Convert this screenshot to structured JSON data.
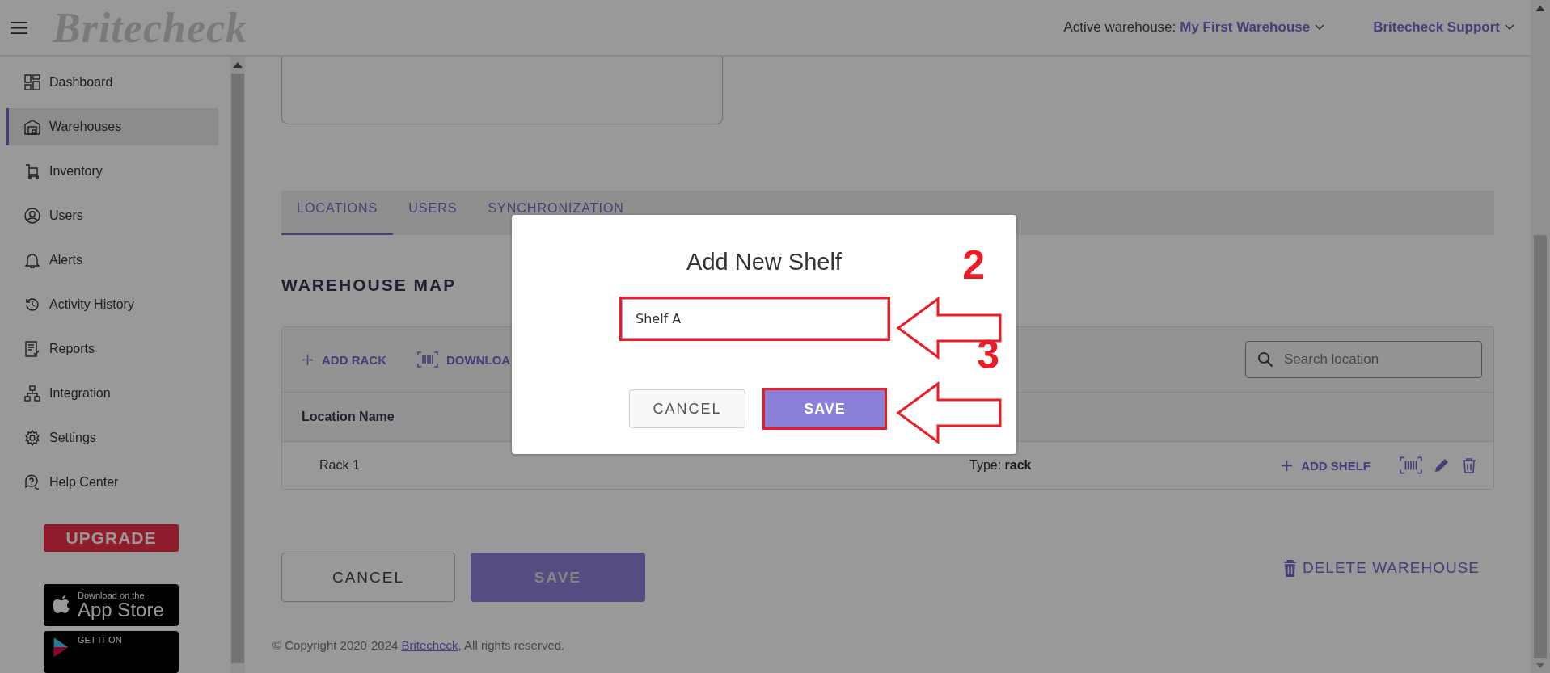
{
  "header": {
    "logo": "Britecheck",
    "active_label": "Active warehouse:",
    "active_warehouse": "My First Warehouse",
    "user": "Britecheck Support"
  },
  "sidebar": {
    "items": [
      {
        "label": "Dashboard",
        "selected": false
      },
      {
        "label": "Warehouses",
        "selected": true
      },
      {
        "label": "Inventory",
        "selected": false
      },
      {
        "label": "Users",
        "selected": false
      },
      {
        "label": "Alerts",
        "selected": false
      },
      {
        "label": "Activity History",
        "selected": false
      },
      {
        "label": "Reports",
        "selected": false
      },
      {
        "label": "Integration",
        "selected": false
      },
      {
        "label": "Settings",
        "selected": false
      },
      {
        "label": "Help Center",
        "selected": false
      }
    ],
    "upgrade": "UPGRADE",
    "app_store": {
      "small": "Download on the",
      "big": "App Store"
    },
    "google_play": {
      "small": "GET IT ON"
    }
  },
  "tabs": [
    {
      "label": "LOCATIONS",
      "selected": true
    },
    {
      "label": "USERS",
      "selected": false
    },
    {
      "label": "SYNCHRONIZATION",
      "selected": false
    }
  ],
  "section_title": "WAREHOUSE MAP",
  "toolbar": {
    "add_rack": "ADD RACK",
    "download": "DOWNLOA",
    "search_placeholder": "Search location"
  },
  "table": {
    "columns": [
      "Location Name"
    ],
    "rows": [
      {
        "name": "Rack 1",
        "type": "Type: **rack**",
        "add_shelf": "ADD SHELF"
      }
    ]
  },
  "form_buttons": {
    "cancel": "CANCEL",
    "save": "SAVE",
    "delete": "DELETE WAREHOUSE"
  },
  "footer": {
    "before": "© Copyright 2020-2024 ",
    "link": "Britecheck",
    "after": ", All rights reserved."
  },
  "modal": {
    "title": "Add New Shelf",
    "input_value": "Shelf A",
    "cancel": "CANCEL",
    "save": "SAVE",
    "annotations": [
      {
        "number": "2"
      },
      {
        "number": "3"
      }
    ]
  }
}
